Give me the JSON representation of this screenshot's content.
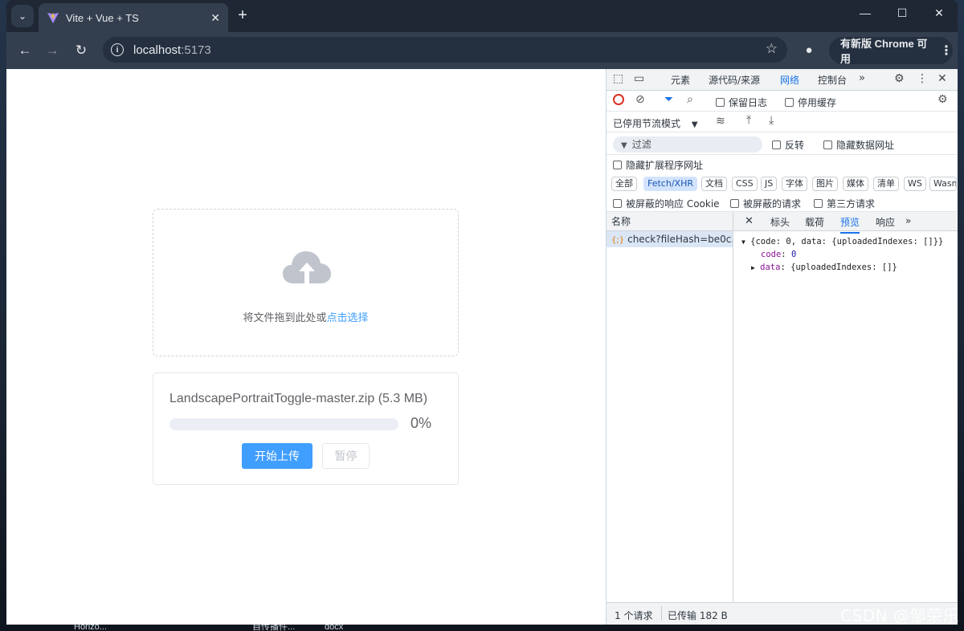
{
  "browser": {
    "tab_title": "Vite + Vue + TS",
    "url_host": "localhost",
    "url_port": ":5173",
    "update_label": "有新版 Chrome 可用"
  },
  "upload": {
    "drop_text": "将文件拖到此处或",
    "drop_link": "点击选择",
    "file_name": "LandscapePortraitToggle-master.zip (5.3 MB)",
    "progress": 0,
    "progress_label": "0%",
    "start_label": "开始上传",
    "pause_label": "暂停"
  },
  "devtools": {
    "tabs": [
      "元素",
      "源代码/来源",
      "网络",
      "控制台"
    ],
    "active_tab": "网络",
    "preserve_log": "保留日志",
    "disable_cache": "停用缓存",
    "throttling": "已停用节流模式",
    "filter_placeholder": "过滤",
    "invert": "反转",
    "hide_data_urls": "隐藏数据网址",
    "hide_extension_urls": "隐藏扩展程序网址",
    "type_filters": [
      "全部",
      "Fetch/XHR",
      "文档",
      "CSS",
      "JS",
      "字体",
      "图片",
      "媒体",
      "清单",
      "WS",
      "Wasm"
    ],
    "active_filter": "Fetch/XHR",
    "blocked_cookies": "被屏蔽的响应 Cookie",
    "blocked_requests": "被屏蔽的请求",
    "third_party": "第三方请求",
    "name_header": "名称",
    "request_name": "check?fileHash=be0c...",
    "detail_tabs": [
      "标头",
      "载荷",
      "预览",
      "响应"
    ],
    "active_detail_tab": "预览",
    "preview": {
      "line1": "{code: 0, data: {uploadedIndexes: []}}",
      "code_key": "code",
      "code_val": "0",
      "data_key": "data",
      "data_val": "{uploadedIndexes: []}"
    },
    "status_requests": "1 个请求",
    "status_transferred": "已传输 182 B"
  },
  "desktop": {
    "taskbar_1": "Horizo...",
    "taskbar_2": "自传播件...",
    "taskbar_3": "docx",
    "watermark": "CSDN @邹荣乐"
  },
  "colors": {
    "primary": "#409eff",
    "devtools_accent": "#1a73e8",
    "chrome_dark": "#333f4f"
  }
}
